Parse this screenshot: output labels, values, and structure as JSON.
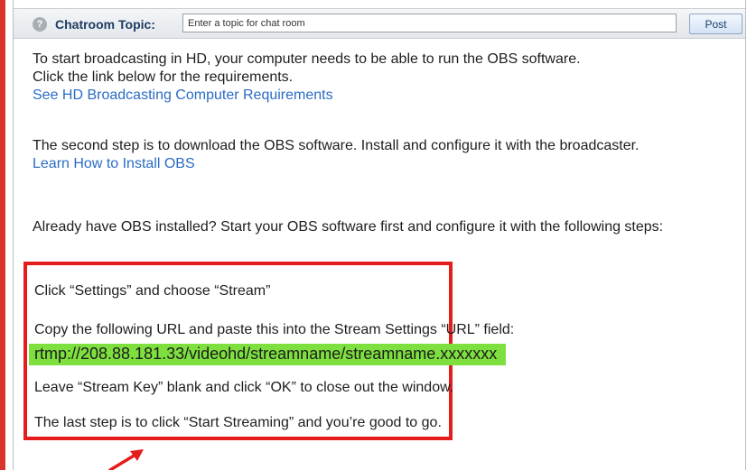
{
  "chatroom": {
    "label": "Chatroom Topic:",
    "input_placeholder": "Enter a topic for chat room",
    "post_label": "Post",
    "help_glyph": "?"
  },
  "content": {
    "intro_line1": "To start broadcasting in HD, your computer needs to be able to run the OBS software.",
    "intro_line2": "Click the link below for the requirements.",
    "requirements_link": "See HD Broadcasting Computer Requirements",
    "step2_text": "The second step is to download the OBS software. Install and configure it with the broadcaster.",
    "install_link": "Learn How to Install OBS",
    "already_text": "Already have OBS installed? Start your OBS software first and configure it with the following steps:"
  },
  "steps": {
    "step1": "Click “Settings” and choose “Stream”",
    "step2": "Copy the following URL and paste this into the Stream Settings “URL” field:",
    "url": "rtmp://208.88.181.33/videohd/streamname/streamname.xxxxxxx",
    "step3": "Leave “Stream Key” blank and click “OK” to close out the window.",
    "step4": "The last step is to click “Start Streaming” and you’re good to go."
  },
  "colors": {
    "highlight_box": "#e41c1c",
    "url_highlight": "#7ee03f",
    "link": "#2b6cc4",
    "topic_label": "#1f3d63"
  }
}
